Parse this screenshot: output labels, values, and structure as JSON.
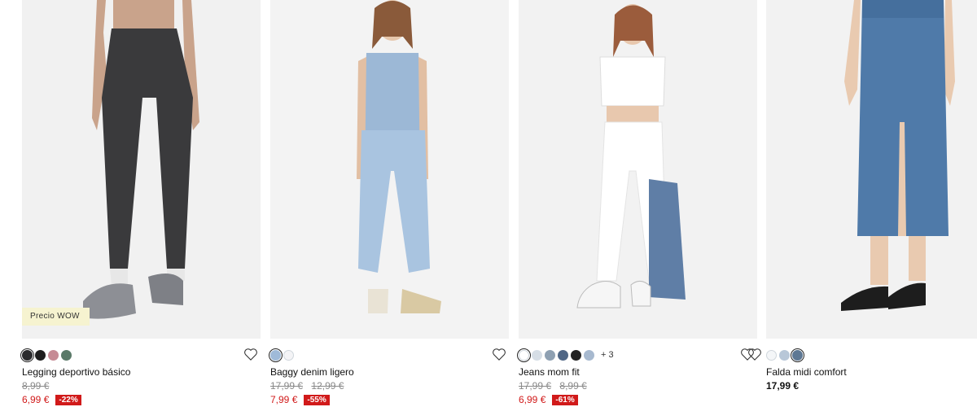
{
  "products": [
    {
      "name": "Legging deportivo básico",
      "tag": "Precio WOW",
      "old_prices": [
        "8,99 €"
      ],
      "price": "6,99 €",
      "discount": "-22%",
      "swatches": [
        "#2b2b2d",
        "#1e1e1e",
        "#c68b95",
        "#5a7968"
      ],
      "extra_colors": "",
      "favorite_icon": "heart-outline-icon"
    },
    {
      "name": "Baggy denim ligero",
      "old_prices": [
        "17,99 €",
        "12,99 €"
      ],
      "price": "7,99 €",
      "discount": "-55%",
      "swatches": [
        "#9fbad8",
        "#f4f4f6"
      ],
      "extra_colors": "",
      "favorite_icon": "heart-outline-icon"
    },
    {
      "name": "Jeans mom fit",
      "old_prices": [
        "17,99 €",
        "8,99 €"
      ],
      "price": "6,99 €",
      "discount": "-61%",
      "swatches": [
        "#ffffff",
        "#d6dee6",
        "#8ea0b2",
        "#4f6685",
        "#222222",
        "#a7b9cf"
      ],
      "extra_colors": "+ 3",
      "favorite_icon": "heart-outline-icon"
    },
    {
      "name": "Falda midi comfort",
      "price": "17,99 €",
      "swatches": [
        "#f4f6f8",
        "#b8c7d8",
        "#5e7894"
      ],
      "extra_colors": "",
      "favorite_icon": "heart-outline-icon"
    }
  ]
}
